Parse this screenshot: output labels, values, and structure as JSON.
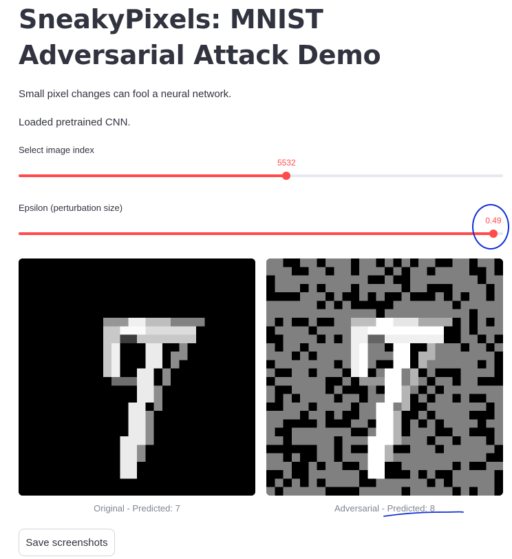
{
  "header": {
    "title": "SneakyPixels: MNIST Adversarial Attack Demo"
  },
  "intro": {
    "description": "Small pixel changes can fool a neural network.",
    "status": "Loaded pretrained CNN."
  },
  "sliders": {
    "image_index": {
      "label": "Select image index",
      "value": "5532",
      "fill_fraction": 0.553
    },
    "epsilon": {
      "label": "Epsilon (perturbation size)",
      "value": "0.49",
      "fill_fraction": 0.98
    }
  },
  "images": {
    "original_caption": "Original - Predicted: 7",
    "adversarial_caption": "Adversarial - Predicted: 8"
  },
  "actions": {
    "save_label": "Save screenshots"
  },
  "colors": {
    "accent": "#ff4b4b",
    "track": "#e6e9ef",
    "annotation": "#1230d8",
    "caption": "#808495",
    "text": "#31333f"
  }
}
